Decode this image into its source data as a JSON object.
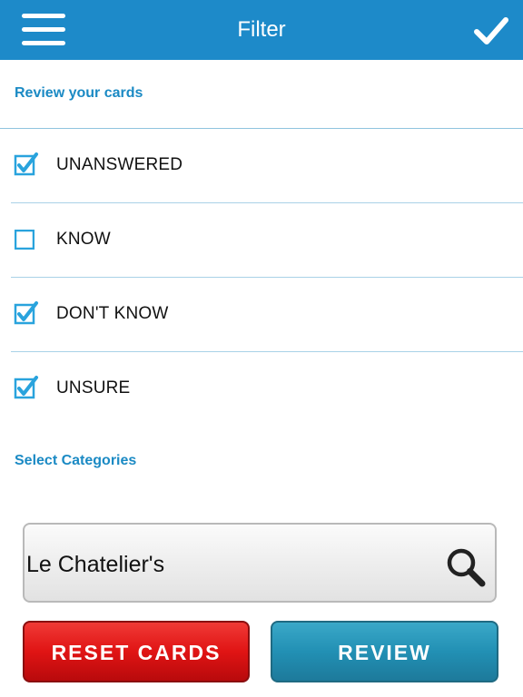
{
  "header": {
    "title": "Filter",
    "menu_icon": "hamburger-menu-icon",
    "confirm_icon": "checkmark-icon",
    "bar_color": "#1d8ac9"
  },
  "review_section": {
    "label": "Review your cards",
    "options": [
      {
        "label": "UNANSWERED",
        "checked": true
      },
      {
        "label": "KNOW",
        "checked": false
      },
      {
        "label": "DON'T KNOW",
        "checked": true
      },
      {
        "label": "UNSURE",
        "checked": true
      }
    ]
  },
  "categories_section": {
    "label": "Select Categories",
    "search_value": "Le Chatelier's",
    "search_icon": "magnifier-icon"
  },
  "actions": {
    "reset_label": "RESET CARDS",
    "review_label": "REVIEW",
    "reset_color": "#e01414",
    "review_color": "#2290b4"
  },
  "accent_color": "#1b8ac4"
}
